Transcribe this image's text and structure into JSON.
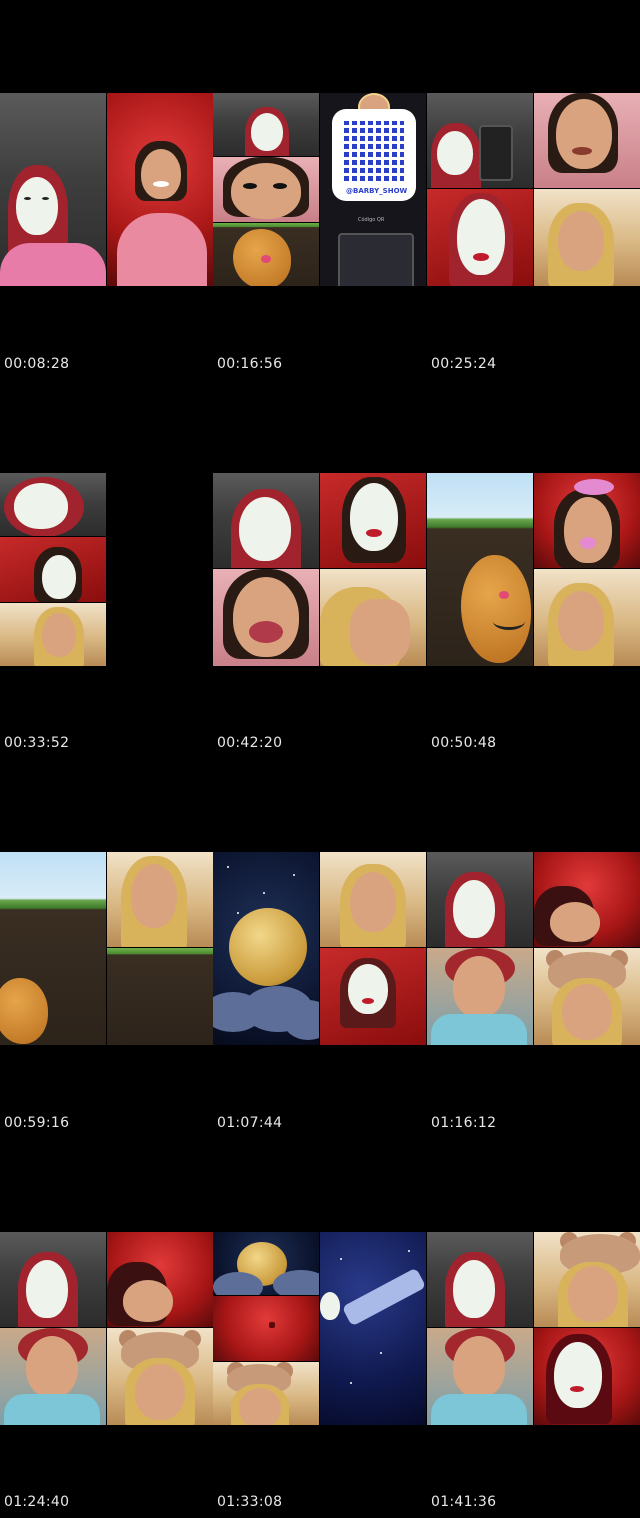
{
  "page": {
    "background": "#000000"
  },
  "rows": [
    {
      "cells": [
        {
          "timestamp": ""
        },
        {
          "timestamp": "00:08:28"
        },
        {
          "timestamp": ""
        }
      ]
    },
    {
      "cells": [
        {
          "timestamp": ""
        },
        {
          "timestamp": "00:16:56"
        },
        {
          "timestamp": ""
        }
      ]
    },
    {
      "cells": [
        {
          "timestamp": ""
        },
        {
          "timestamp": "00:25:24"
        },
        {
          "timestamp": ""
        }
      ]
    }
  ],
  "timestamps": [
    "00:08:28",
    "00:16:56",
    "00:25:24",
    "00:33:52",
    "00:42:20",
    "00:50:48",
    "00:59:16",
    "01:07:44",
    "01:16:12",
    "01:24:40",
    "01:33:08",
    "01:41:36"
  ],
  "qr_username": "@BARBY_SHOW",
  "qr_caption": "Código QR"
}
